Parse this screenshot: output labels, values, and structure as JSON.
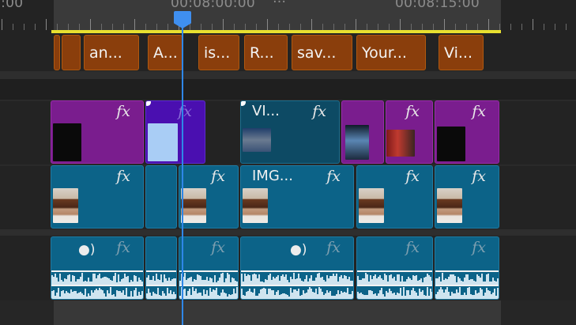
{
  "ruler": {
    "left_timecode": "5:00",
    "center_timecode": "00:08:00:00",
    "right_timecode": "00:08:15:00",
    "marker_glyph": "…"
  },
  "tracks": {
    "titles": {
      "clips": [
        {
          "label": ""
        },
        {
          "label": ""
        },
        {
          "label": "an..."
        },
        {
          "label": "A..."
        },
        {
          "label": "is..."
        },
        {
          "label": "R..."
        },
        {
          "label": "sav..."
        },
        {
          "label": "Your..."
        },
        {
          "label": "Vi..."
        }
      ]
    },
    "v2": {
      "clips": [
        {
          "label": "",
          "fx": "fx"
        },
        {
          "label": "",
          "fx": "fx"
        },
        {
          "label": "VI...",
          "fx": "fx"
        },
        {
          "label": "",
          "fx": ""
        },
        {
          "label": "",
          "fx": "fx"
        },
        {
          "label": "",
          "fx": "fx"
        }
      ]
    },
    "v1": {
      "clips": [
        {
          "label": "",
          "fx": "fx"
        },
        {
          "label": "",
          "fx": ""
        },
        {
          "label": "",
          "fx": "fx"
        },
        {
          "label": "IMG...",
          "fx": "fx"
        },
        {
          "label": "",
          "fx": "fx"
        },
        {
          "label": "",
          "fx": "fx"
        }
      ]
    },
    "a1": {
      "clips": [
        {
          "fx": "fx"
        },
        {
          "fx": ""
        },
        {
          "fx": "fx"
        },
        {
          "fx": "fx"
        },
        {
          "fx": "fx"
        },
        {
          "fx": "fx"
        }
      ]
    }
  },
  "colors": {
    "title_clip": "#8a3e0c",
    "v2_clip": "#7a1d8e",
    "v1_clip": "#0c6388",
    "playhead": "#2f87e8",
    "work_area_bar": "#e8e030"
  },
  "icons": {
    "effect": "fx-badge-icon",
    "voice": "speaking-head-icon",
    "playhead": "playhead-icon"
  }
}
